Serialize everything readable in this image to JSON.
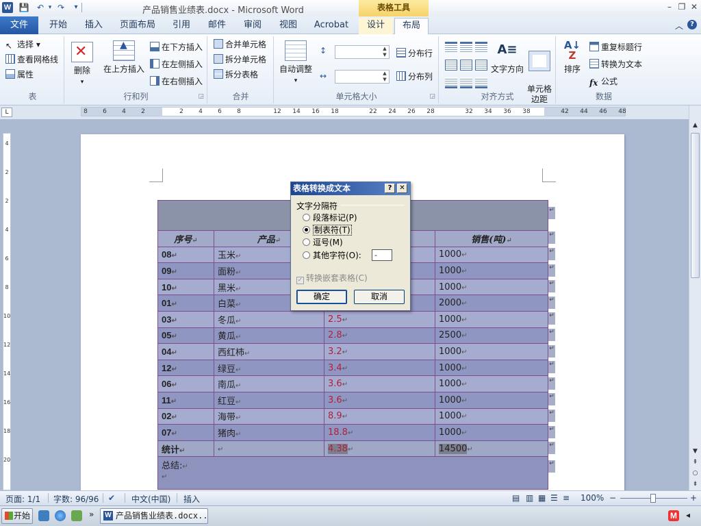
{
  "window": {
    "title": "产品销售业绩表.docx - Microsoft Word",
    "context_tab_header": "表格工具",
    "minimize": "–",
    "restore": "❐",
    "close": "✕"
  },
  "qat": {
    "save": "💾",
    "undo": "↶",
    "redo": "↷",
    "customize": "▾"
  },
  "tabs": [
    {
      "label": "文件"
    },
    {
      "label": "开始"
    },
    {
      "label": "插入"
    },
    {
      "label": "页面布局"
    },
    {
      "label": "引用"
    },
    {
      "label": "邮件"
    },
    {
      "label": "审阅"
    },
    {
      "label": "视图"
    },
    {
      "label": "Acrobat"
    },
    {
      "label": "设计"
    },
    {
      "label": "布局"
    }
  ],
  "active_tab": "布局",
  "ribbon": {
    "table_group": {
      "label": "表",
      "select": "选择 ▾",
      "view_gridlines": "查看网格线",
      "properties": "属性"
    },
    "rows_cols_group": {
      "label": "行和列",
      "delete": "删除",
      "delete_arrow": "▾",
      "insert_above": "在上方插入",
      "insert_below": "在下方插入",
      "insert_left": "在左侧插入",
      "insert_right": "在右侧插入"
    },
    "merge_group": {
      "label": "合并",
      "merge_cells": "合并单元格",
      "split_cells": "拆分单元格",
      "split_table": "拆分表格"
    },
    "cell_size_group": {
      "label": "单元格大小",
      "autofit": "自动调整",
      "autofit_arrow": "▾",
      "distribute_rows": "分布行",
      "distribute_cols": "分布列"
    },
    "alignment_group": {
      "label": "对齐方式",
      "text_direction": "文字方向",
      "cell_margins": "单元格\n边距"
    },
    "data_group": {
      "label": "数据",
      "sort": "排序",
      "repeat_header": "重复标题行",
      "convert_to_text": "转换为文本",
      "formula": "公式"
    }
  },
  "ruler": {
    "numbers": [
      "8",
      "6",
      "4",
      "2",
      "2",
      "4",
      "6",
      "8",
      "12",
      "14",
      "16",
      "18",
      "22",
      "24",
      "26",
      "28",
      "32",
      "34",
      "36",
      "38",
      "42",
      "44",
      "46",
      "48"
    ],
    "vertical_numbers": [
      "4",
      "2",
      "2",
      "4",
      "6",
      "8",
      "10",
      "12",
      "14",
      "16",
      "18",
      "20"
    ]
  },
  "document": {
    "table": {
      "headers": [
        "序号",
        "产品",
        "单价",
        "销售(吨)"
      ],
      "rows": [
        {
          "id": "08",
          "product": "玉米",
          "price": "",
          "sales": "1000"
        },
        {
          "id": "09",
          "product": "面粉",
          "price": "",
          "sales": "1000"
        },
        {
          "id": "10",
          "product": "黑米",
          "price": "",
          "sales": "1000"
        },
        {
          "id": "01",
          "product": "白菜",
          "price": "",
          "sales": "2000"
        },
        {
          "id": "03",
          "product": "冬瓜",
          "price": "2.5",
          "sales": "1000"
        },
        {
          "id": "05",
          "product": "黄瓜",
          "price": "2.8",
          "sales": "2500"
        },
        {
          "id": "04",
          "product": "西红柿",
          "price": "3.2",
          "sales": "1000"
        },
        {
          "id": "12",
          "product": "绿豆",
          "price": "3.4",
          "sales": "1000"
        },
        {
          "id": "06",
          "product": "南瓜",
          "price": "3.6",
          "sales": "1000"
        },
        {
          "id": "11",
          "product": "红豆",
          "price": "3.6",
          "sales": "1000"
        },
        {
          "id": "02",
          "product": "海带",
          "price": "8.9",
          "sales": "1000"
        },
        {
          "id": "07",
          "product": "猪肉",
          "price": "18.8",
          "sales": "1000"
        }
      ],
      "total": {
        "label": "统计",
        "price": "4.38",
        "sales": "14500"
      },
      "summary_label": "总结:"
    },
    "paragraph_mark": "↵"
  },
  "dialog": {
    "title": "表格转换成文本",
    "help_btn": "?",
    "close_btn": "✕",
    "section_label": "文字分隔符",
    "options": [
      {
        "label": "段落标记(P)",
        "selected": false
      },
      {
        "label": "制表符(T)",
        "selected": true
      },
      {
        "label": "逗号(M)",
        "selected": false
      },
      {
        "label": "其他字符(O):",
        "selected": false
      }
    ],
    "other_char_value": "-",
    "nested_checkbox": "转换嵌套表格(C)",
    "nested_checked": true,
    "ok": "确定",
    "cancel": "取消"
  },
  "statusbar": {
    "page": "页面: 1/1",
    "words": "字数: 96/96",
    "language": "中文(中国)",
    "mode": "插入",
    "zoom": "100%",
    "zoom_minus": "−",
    "zoom_plus": "+"
  },
  "taskbar": {
    "start": "开始",
    "task": "产品销售业绩表.docx...",
    "more": "»"
  },
  "colors": {
    "accent": "#2b579a",
    "table_border": "#7b4e8f",
    "price_red": "#b0203a"
  }
}
